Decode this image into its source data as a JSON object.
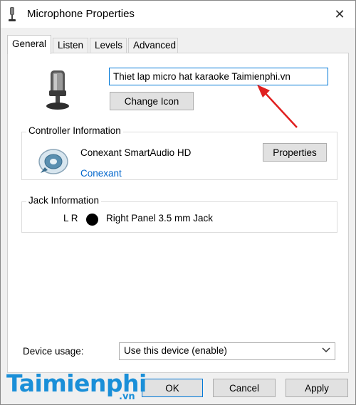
{
  "window": {
    "title": "Microphone Properties",
    "close_label": "✕"
  },
  "tabs": [
    {
      "label": "General",
      "active": true
    },
    {
      "label": "Listen",
      "active": false
    },
    {
      "label": "Levels",
      "active": false
    },
    {
      "label": "Advanced",
      "active": false
    }
  ],
  "general": {
    "device_name_value": "Thiet lap micro hat karaoke Taimienphi.vn",
    "change_icon_label": "Change Icon"
  },
  "controller": {
    "group_label": "Controller Information",
    "device_name": "Conexant SmartAudio HD",
    "vendor_link": "Conexant",
    "properties_label": "Properties"
  },
  "jack": {
    "group_label": "Jack Information",
    "channels": "L R",
    "jack_color": "#000000",
    "description": "Right Panel 3.5 mm Jack"
  },
  "device_usage": {
    "label": "Device usage:",
    "selected": "Use this device (enable)"
  },
  "footer": {
    "ok_label": "OK",
    "cancel_label": "Cancel",
    "apply_label": "Apply"
  },
  "watermark": {
    "text": "Taimienphi",
    "suffix": ".vn"
  },
  "colors": {
    "accent": "#0078d7",
    "link": "#0066cc",
    "annotation_arrow": "#e02020",
    "watermark": "#1a8fd8"
  }
}
